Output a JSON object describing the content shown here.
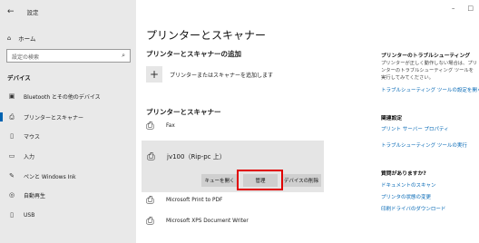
{
  "window": {
    "title": "設定",
    "controls": {
      "minimize": "–",
      "maximize": "□"
    }
  },
  "sidebar": {
    "home": "ホーム",
    "search_placeholder": "設定の検索",
    "section": "デバイス",
    "items": [
      {
        "label": "Bluetooth とその他のデバイス",
        "icon": "bluetooth-icon"
      },
      {
        "label": "プリンターとスキャナー",
        "icon": "printer-icon",
        "active": true
      },
      {
        "label": "マウス",
        "icon": "mouse-icon"
      },
      {
        "label": "入力",
        "icon": "keyboard-icon"
      },
      {
        "label": "ペンと Windows Ink",
        "icon": "pen-icon"
      },
      {
        "label": "自動再生",
        "icon": "autoplay-icon"
      },
      {
        "label": "USB",
        "icon": "usb-icon"
      }
    ]
  },
  "main": {
    "title": "プリンターとスキャナー",
    "add_section": "プリンターとスキャナーの追加",
    "add_label": "プリンターまたはスキャナーを追加します",
    "printers_section": "プリンターとスキャナー",
    "printers": [
      {
        "name": "Fax"
      },
      {
        "name": "jv100（Rip-pc 上）",
        "selected": true
      },
      {
        "name": "Microsoft Print to PDF"
      },
      {
        "name": "Microsoft XPS Document Writer"
      }
    ],
    "buttons": {
      "queue": "キューを開く",
      "manage": "管理",
      "remove": "デバイスの削除"
    }
  },
  "right_panel": {
    "troubleshoot_title": "プリンターのトラブルシューティング",
    "troubleshoot_text": "プリンターが正しく動作しない場合は、プリンターのトラブルシューティング ツールを実行してみてください。",
    "troubleshoot_link": "トラブルシューティング ツールの設定を開く",
    "related_title": "関連設定",
    "related_links": [
      "プリント サーバー プロパティ",
      "トラブルシューティング ツールの実行"
    ],
    "questions_title": "質問がありますか?",
    "question_links": [
      "ドキュメントのスキャン",
      "プリンタの状態の変更",
      "印刷ドライバのダウンロード"
    ]
  }
}
